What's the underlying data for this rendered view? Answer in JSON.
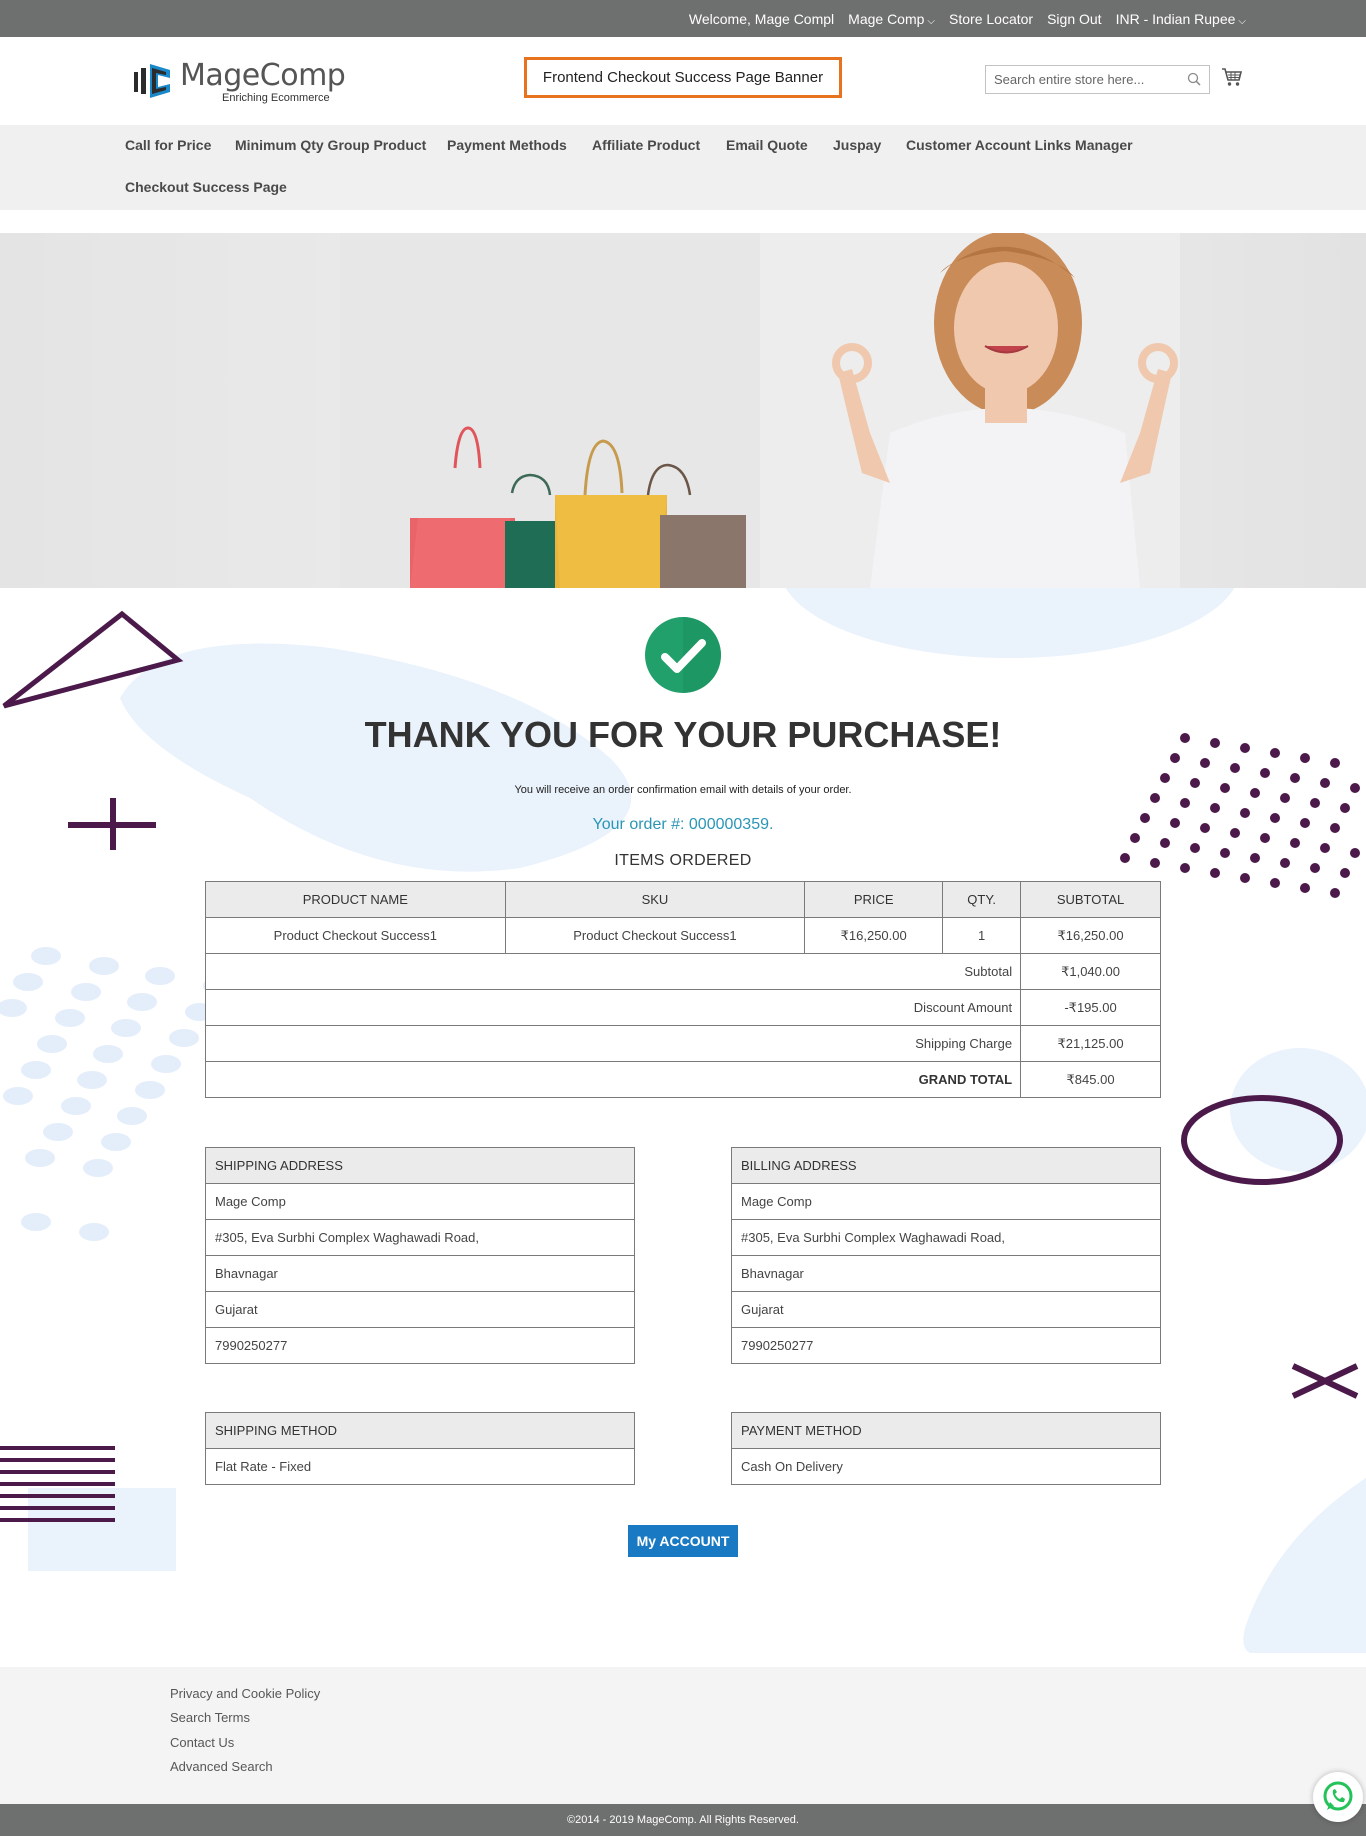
{
  "topbar": {
    "welcome": "Welcome, Mage Compl",
    "account_menu": "Mage Comp",
    "store_locator": "Store Locator",
    "sign_out": "Sign Out",
    "currency": "INR - Indian Rupee",
    "bg_color": "#6e6f6f"
  },
  "header": {
    "logo_name": "MageComp",
    "logo_tagline": "Enriching Ecommerce",
    "banner_label": "Frontend Checkout Success Page Banner",
    "search_placeholder": "Search entire store here...",
    "cart_icon": "cart-icon",
    "search_icon": "search-icon",
    "banner_border_color": "#e8731f"
  },
  "nav": {
    "items": [
      {
        "label": "Call for Price"
      },
      {
        "label": "Minimum Qty Group Product"
      },
      {
        "label": "Payment Methods"
      },
      {
        "label": "Affiliate Product"
      },
      {
        "label": "Email Quote"
      },
      {
        "label": "Juspay"
      },
      {
        "label": "Customer Account Links Manager"
      },
      {
        "label": "Checkout Success Page"
      }
    ]
  },
  "success": {
    "title": "THANK YOU FOR YOUR PURCHASE!",
    "message": "You will receive an order confirmation email with details of your order.",
    "order_label": "Your order #: ",
    "order_number": "000000359",
    "order_suffix": ".",
    "items_title": "ITEMS ORDERED",
    "check_color": "#22a06b",
    "order_color": "#2a96b6"
  },
  "order_table": {
    "headers": [
      "PRODUCT NAME",
      "SKU",
      "PRICE",
      "QTY.",
      "SUBTOTAL"
    ],
    "rows": [
      {
        "name": "Product Checkout Success1",
        "sku": "Product Checkout Success1",
        "price": "₹16,250.00",
        "qty": "1",
        "subtotal": "₹16,250.00"
      }
    ],
    "totals": [
      {
        "label": "Subtotal",
        "value": "₹1,040.00"
      },
      {
        "label": "Discount Amount",
        "value": "-₹195.00"
      },
      {
        "label": "Shipping Charge",
        "value": "₹21,125.00"
      }
    ],
    "grand_total": {
      "label": "GRAND TOTAL",
      "value": "₹845.00"
    }
  },
  "shipping_address": {
    "title": "SHIPPING ADDRESS",
    "lines": [
      "Mage Comp",
      "#305, Eva Surbhi Complex Waghawadi Road,",
      "Bhavnagar",
      "Gujarat",
      "7990250277"
    ]
  },
  "billing_address": {
    "title": "BILLING ADDRESS",
    "lines": [
      "Mage Comp",
      "#305, Eva Surbhi Complex Waghawadi Road,",
      "Bhavnagar",
      "Gujarat",
      "7990250277"
    ]
  },
  "shipping_method": {
    "title": "SHIPPING METHOD",
    "value": "Flat Rate - Fixed"
  },
  "payment_method": {
    "title": "PAYMENT METHOD",
    "value": "Cash On Delivery"
  },
  "account_button": {
    "label": "My ACCOUNT",
    "color": "#1979c3"
  },
  "footer": {
    "links": [
      "Privacy and Cookie Policy",
      "Search Terms",
      "Contact Us",
      "Advanced Search"
    ],
    "copyright": "©2014 - 2019 MageComp. All Rights Reserved.",
    "chat_icon": "whatsapp-icon"
  }
}
